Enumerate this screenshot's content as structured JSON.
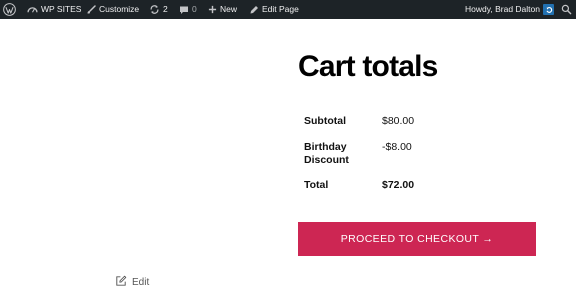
{
  "admin_bar": {
    "site_name": "WP SITES",
    "customize": "Customize",
    "updates_count": "2",
    "comments_count": "0",
    "new": "New",
    "edit_page": "Edit Page",
    "howdy": "Howdy, Brad Dalton",
    "icons": [
      "wordpress-icon",
      "dashboard-icon",
      "brush-icon",
      "updates-icon",
      "comment-icon",
      "plus-icon",
      "pencil-icon",
      "avatar-icon",
      "search-icon"
    ]
  },
  "cart_totals": {
    "title": "Cart totals",
    "rows": [
      {
        "label": "Subtotal",
        "value": "$80.00"
      },
      {
        "label": "Birthday Discount",
        "value": "-$8.00"
      },
      {
        "label": "Total",
        "value": "$72.00"
      }
    ],
    "checkout_label": "PROCEED TO CHECKOUT →",
    "accent_color": "#cd2653"
  },
  "edit_link": {
    "label": "Edit"
  }
}
